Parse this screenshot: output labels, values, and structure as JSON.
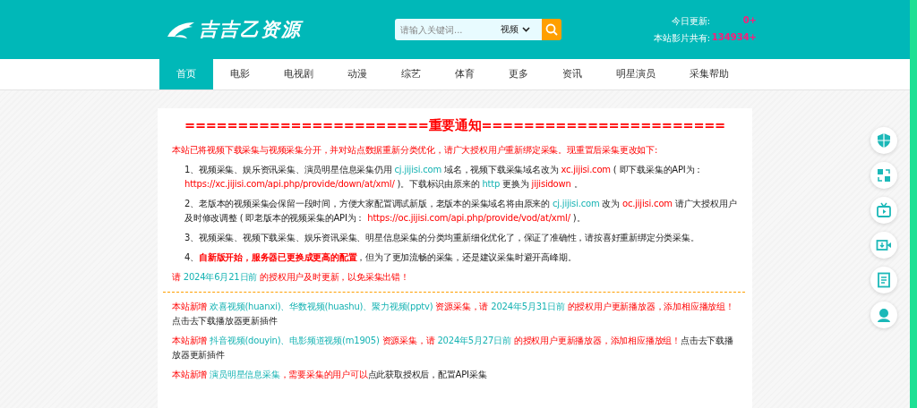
{
  "header": {
    "logo_text": "吉吉乙资源",
    "search": {
      "placeholder": "请输入关键词...",
      "category": "视频"
    },
    "stats": [
      {
        "label": "今日更新:",
        "value": "0+"
      },
      {
        "label": "本站影片共有:",
        "value": "134934+"
      }
    ]
  },
  "nav": [
    {
      "label": "首页",
      "selected": true
    },
    {
      "label": "电影",
      "selected": false
    },
    {
      "label": "电视剧",
      "selected": false
    },
    {
      "label": "动漫",
      "selected": false
    },
    {
      "label": "综艺",
      "selected": false
    },
    {
      "label": "体育",
      "selected": false
    },
    {
      "label": "更多",
      "selected": false
    },
    {
      "label": "资讯",
      "selected": false
    },
    {
      "label": "明星演员",
      "selected": false
    },
    {
      "label": "采集帮助",
      "selected": false
    }
  ],
  "notice": {
    "title": "=======================重要通知=======================",
    "intro": [
      {
        "kind": "red",
        "text": "本站已将视频下载采集与视频采集分开，并对站点数据重新分类优化，请广大授权用户重新绑定采集。现重置后采集更改如下:"
      }
    ],
    "items": [
      [
        {
          "kind": "plain",
          "text": "1、视频采集、娱乐资讯采集、演员明星信息采集仍用 "
        },
        {
          "kind": "teal",
          "text": "cj.jijisi.com"
        },
        {
          "kind": "plain",
          "text": " 域名，视频下载采集域名改为 "
        },
        {
          "kind": "red",
          "text": "xc.jijisi.com"
        },
        {
          "kind": "plain",
          "text": " ( 即下载采集的API为："
        },
        {
          "kind": "red",
          "text": "https://xc.jijisi.com/api.php/provide/down/at/xml/"
        },
        {
          "kind": "plain",
          "text": " )。下载标识由原来的 "
        },
        {
          "kind": "teal",
          "text": "http"
        },
        {
          "kind": "plain",
          "text": " 更换为 "
        },
        {
          "kind": "red",
          "text": "jijisidown"
        },
        {
          "kind": "plain",
          "text": " 。"
        }
      ],
      [
        {
          "kind": "plain",
          "text": "2、老版本的视频采集会保留一段时间，方便大家配置调试新版，老版本的采集域名将由原来的 "
        },
        {
          "kind": "teal",
          "text": "cj.jijisi.com"
        },
        {
          "kind": "plain",
          "text": " 改为 "
        },
        {
          "kind": "red",
          "text": "oc.jijisi.com"
        },
        {
          "kind": "plain",
          "text": " 请广大授权用户及时修改调整 ( 即老版本的视频采集的API为： "
        },
        {
          "kind": "red",
          "text": "https://oc.jijisi.com/api.php/provide/vod/at/xml/"
        },
        {
          "kind": "plain",
          "text": " )。"
        }
      ],
      [
        {
          "kind": "plain",
          "text": "3、视频采集、视频下载采集、娱乐资讯采集、明星信息采集的分类均重新细化优化了，保证了准确性，请按喜好重新绑定分类采集。"
        }
      ],
      [
        {
          "kind": "plain",
          "text": "4、"
        },
        {
          "kind": "strong",
          "text": "自新版开始，服务器已更换成更高的配置"
        },
        {
          "kind": "plain",
          "text": "，但为了更加流畅的采集，还是建议采集时避开高峰期。"
        }
      ]
    ],
    "deadline": [
      {
        "kind": "red",
        "text": "请 "
      },
      {
        "kind": "teal",
        "text": "2024年6月21日前"
      },
      {
        "kind": "red",
        "text": " 的授权用户及时更新，以免采集出错！"
      }
    ],
    "news": [
      [
        {
          "kind": "red",
          "text": "本站新增 "
        },
        {
          "kind": "teal",
          "text": "欢喜视频(huanxi)、华数视频(huashu)、聚力视频(pptv)"
        },
        {
          "kind": "red",
          "text": " 资源采集，请 "
        },
        {
          "kind": "teal",
          "text": "2024年5月31日前"
        },
        {
          "kind": "red",
          "text": " 的授权用户更新播放器，添加相应播放组！"
        },
        {
          "kind": "plain",
          "text": "点击去下载播放器更新插件"
        }
      ],
      [
        {
          "kind": "red",
          "text": "本站新增 "
        },
        {
          "kind": "teal",
          "text": "抖音视频(douyin)、电影频道视频(m1905)"
        },
        {
          "kind": "red",
          "text": " 资源采集，请 "
        },
        {
          "kind": "teal",
          "text": "2024年5月27日前"
        },
        {
          "kind": "red",
          "text": " 的授权用户更新播放器，添加相应播放组！"
        },
        {
          "kind": "plain",
          "text": "点击去下载播放器更新插件"
        }
      ],
      [
        {
          "kind": "red",
          "text": "本站新增 "
        },
        {
          "kind": "teal",
          "text": "演员明星信息采集"
        },
        {
          "kind": "red",
          "text": "，需要采集的用户可以"
        },
        {
          "kind": "plain",
          "text": "点此获取授权后，配置API采集"
        }
      ]
    ]
  }
}
